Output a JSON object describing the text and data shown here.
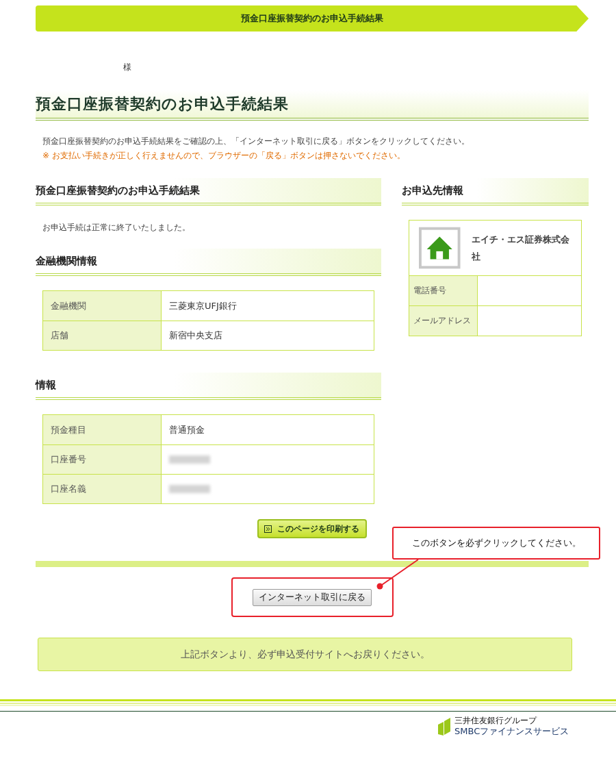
{
  "banner": {
    "title": "預金口座振替契約のお申込手続結果"
  },
  "customer": {
    "honorific": "様"
  },
  "page_title": "預金口座振替契約のお申込手続結果",
  "intro": {
    "text": "預金口座振替契約のお申込手続結果をご確認の上、「インターネット取引に戻る」ボタンをクリックしてください。",
    "warning": "※ お支払い手続きが正しく行えませんので、ブラウザーの「戻る」ボタンは押さないでください。"
  },
  "result_section": {
    "heading": "預金口座振替契約のお申込手続結果",
    "message": "お申込手続は正常に終了いたしました。"
  },
  "sections": [
    {
      "heading": "金融機関情報",
      "rows": [
        {
          "label": "金融機関",
          "value": "三菱東京UFJ銀行",
          "redacted": false
        },
        {
          "label": "店舗",
          "value": "新宿中央支店",
          "redacted": false
        }
      ]
    },
    {
      "heading": "情報",
      "rows": [
        {
          "label": "預金種目",
          "value": "普通預金",
          "redacted": false
        },
        {
          "label": "口座番号",
          "redacted": true
        },
        {
          "label": "口座名義",
          "redacted": true
        }
      ]
    }
  ],
  "payee": {
    "heading": "お申込先情報",
    "name": "エイチ・エス証券株式会社",
    "rows": [
      {
        "label": "電話番号"
      },
      {
        "label": "メールアドレス"
      }
    ]
  },
  "print_button": "このページを印刷する",
  "callout": "このボタンを必ずクリックしてください。",
  "return_button": "インターネット取引に戻る",
  "notice": "上記ボタンより、必ず申込受付サイトへお戻りください。",
  "footer": {
    "logo_group": "三井住友銀行グループ",
    "logo_name": "SMBCファイナンスサービス"
  }
}
